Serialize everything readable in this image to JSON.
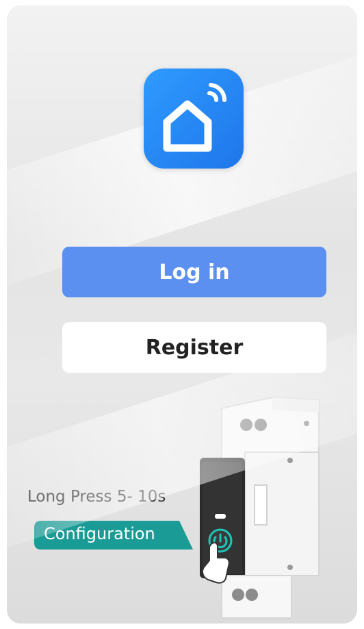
{
  "login": {
    "label": "Log in"
  },
  "register": {
    "label": "Register"
  },
  "instruction": {
    "press_text": "Long Press 5- 10s",
    "config_label": "Configuration"
  },
  "colors": {
    "app_icon": "#1f86f0",
    "login_button": "#5b8ff0",
    "register_button": "#ffffff",
    "config_tag": "#1a9b95"
  },
  "icons": {
    "app": "smart-home-icon",
    "device_button": "power-icon"
  }
}
